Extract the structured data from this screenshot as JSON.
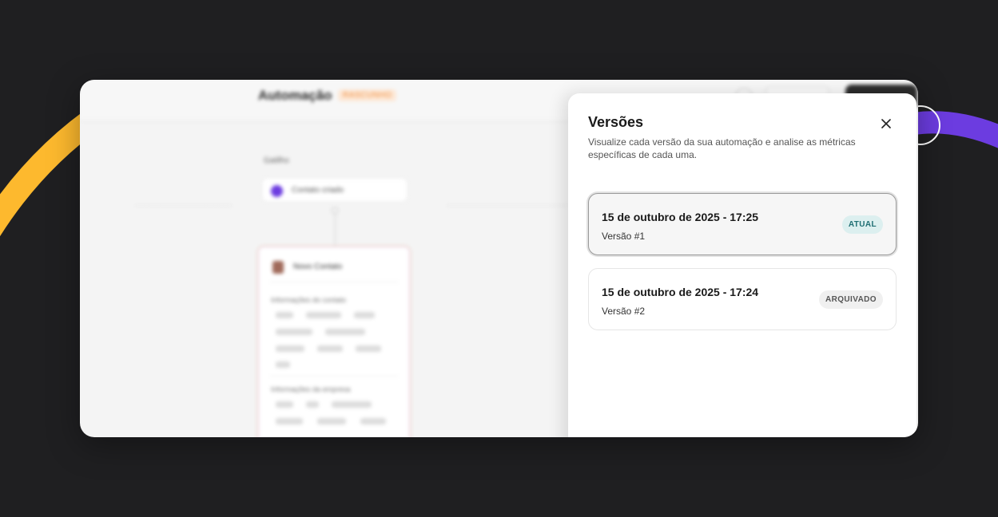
{
  "colors": {
    "background": "#1f1f21",
    "accent_yellow": "#fdb92e",
    "accent_purple": "#6c3ce0",
    "badge_current_bg": "#dcefef",
    "badge_current_text": "#1f6f73",
    "badge_archived_bg": "#f0f0f0"
  },
  "app": {
    "title": "Automação",
    "status_badge": "RASCUNHO",
    "trigger_label": "Gatilho",
    "trigger_text": "Contato criado",
    "node_title": "Novo Contato",
    "node_section_1": "Informações do contato",
    "node_section_2": "Informações da empresa"
  },
  "panel": {
    "title": "Versões",
    "subtitle": "Visualize cada versão da sua automação e analise as métricas específicas de cada uma.",
    "close_icon": "close-icon",
    "versions": [
      {
        "date": "15 de outubro de 2025 - 17:25",
        "name": "Versão #1",
        "status": "ATUAL"
      },
      {
        "date": "15 de outubro de 2025 - 17:24",
        "name": "Versão #2",
        "status": "ARQUIVADO"
      }
    ]
  }
}
